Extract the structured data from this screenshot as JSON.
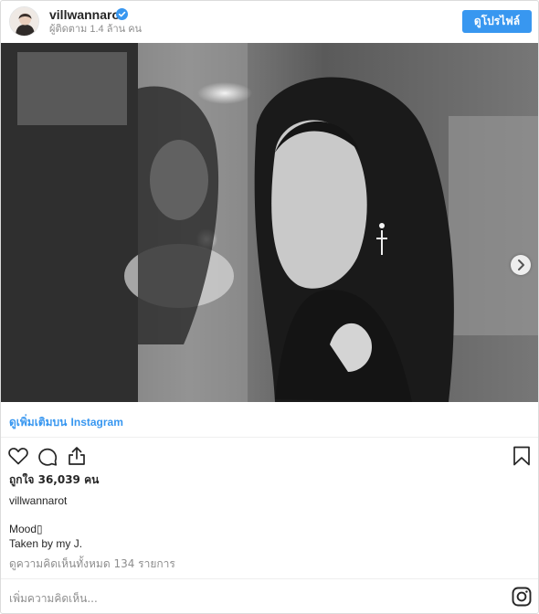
{
  "header": {
    "username": "villwannarot",
    "followers": "ผู้ติดตาม 1.4 ล้าน คน",
    "view_profile_label": "ดูโปรไฟล์"
  },
  "links": {
    "view_more_prefix": "ดูเพิ่มเติมบน",
    "view_more_platform": "Instagram"
  },
  "actions": {
    "icons": [
      "heart-icon",
      "comment-icon",
      "share-icon",
      "bookmark-icon",
      "instagram-logo-icon",
      "chevron-right-icon",
      "verified-badge-icon"
    ]
  },
  "post": {
    "likes": "ถูกใจ 36,039 คน",
    "caption_user": "villwannarot",
    "caption_line1": "Mood▯",
    "caption_line2": "Taken by my J.",
    "comments": "ดูความคิดเห็นทั้งหมด 134 รายการ"
  },
  "comment_box": {
    "placeholder": "เพิ่มความคิดเห็น..."
  },
  "colors": {
    "accent": "#3897f0",
    "text": "#262626",
    "muted": "#8e8e8e",
    "border": "#dbdbdb"
  }
}
